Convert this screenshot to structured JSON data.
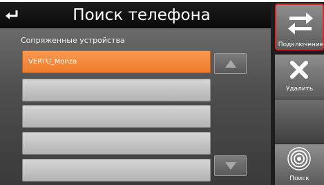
{
  "header": {
    "title": "Поиск телефона"
  },
  "devices": {
    "section_label": "Сопряженные устройства",
    "items": [
      {
        "label": "VERTU_Monza",
        "selected": true
      },
      {
        "label": "",
        "selected": false
      },
      {
        "label": "",
        "selected": false
      },
      {
        "label": "",
        "selected": false
      },
      {
        "label": "",
        "selected": false
      }
    ]
  },
  "side_panel": {
    "connect_label": "Подключение",
    "delete_label": "Удалить",
    "search_label": "Поиск"
  },
  "colors": {
    "selected_row": "#ef7b2b",
    "active_border": "#d7272b"
  }
}
